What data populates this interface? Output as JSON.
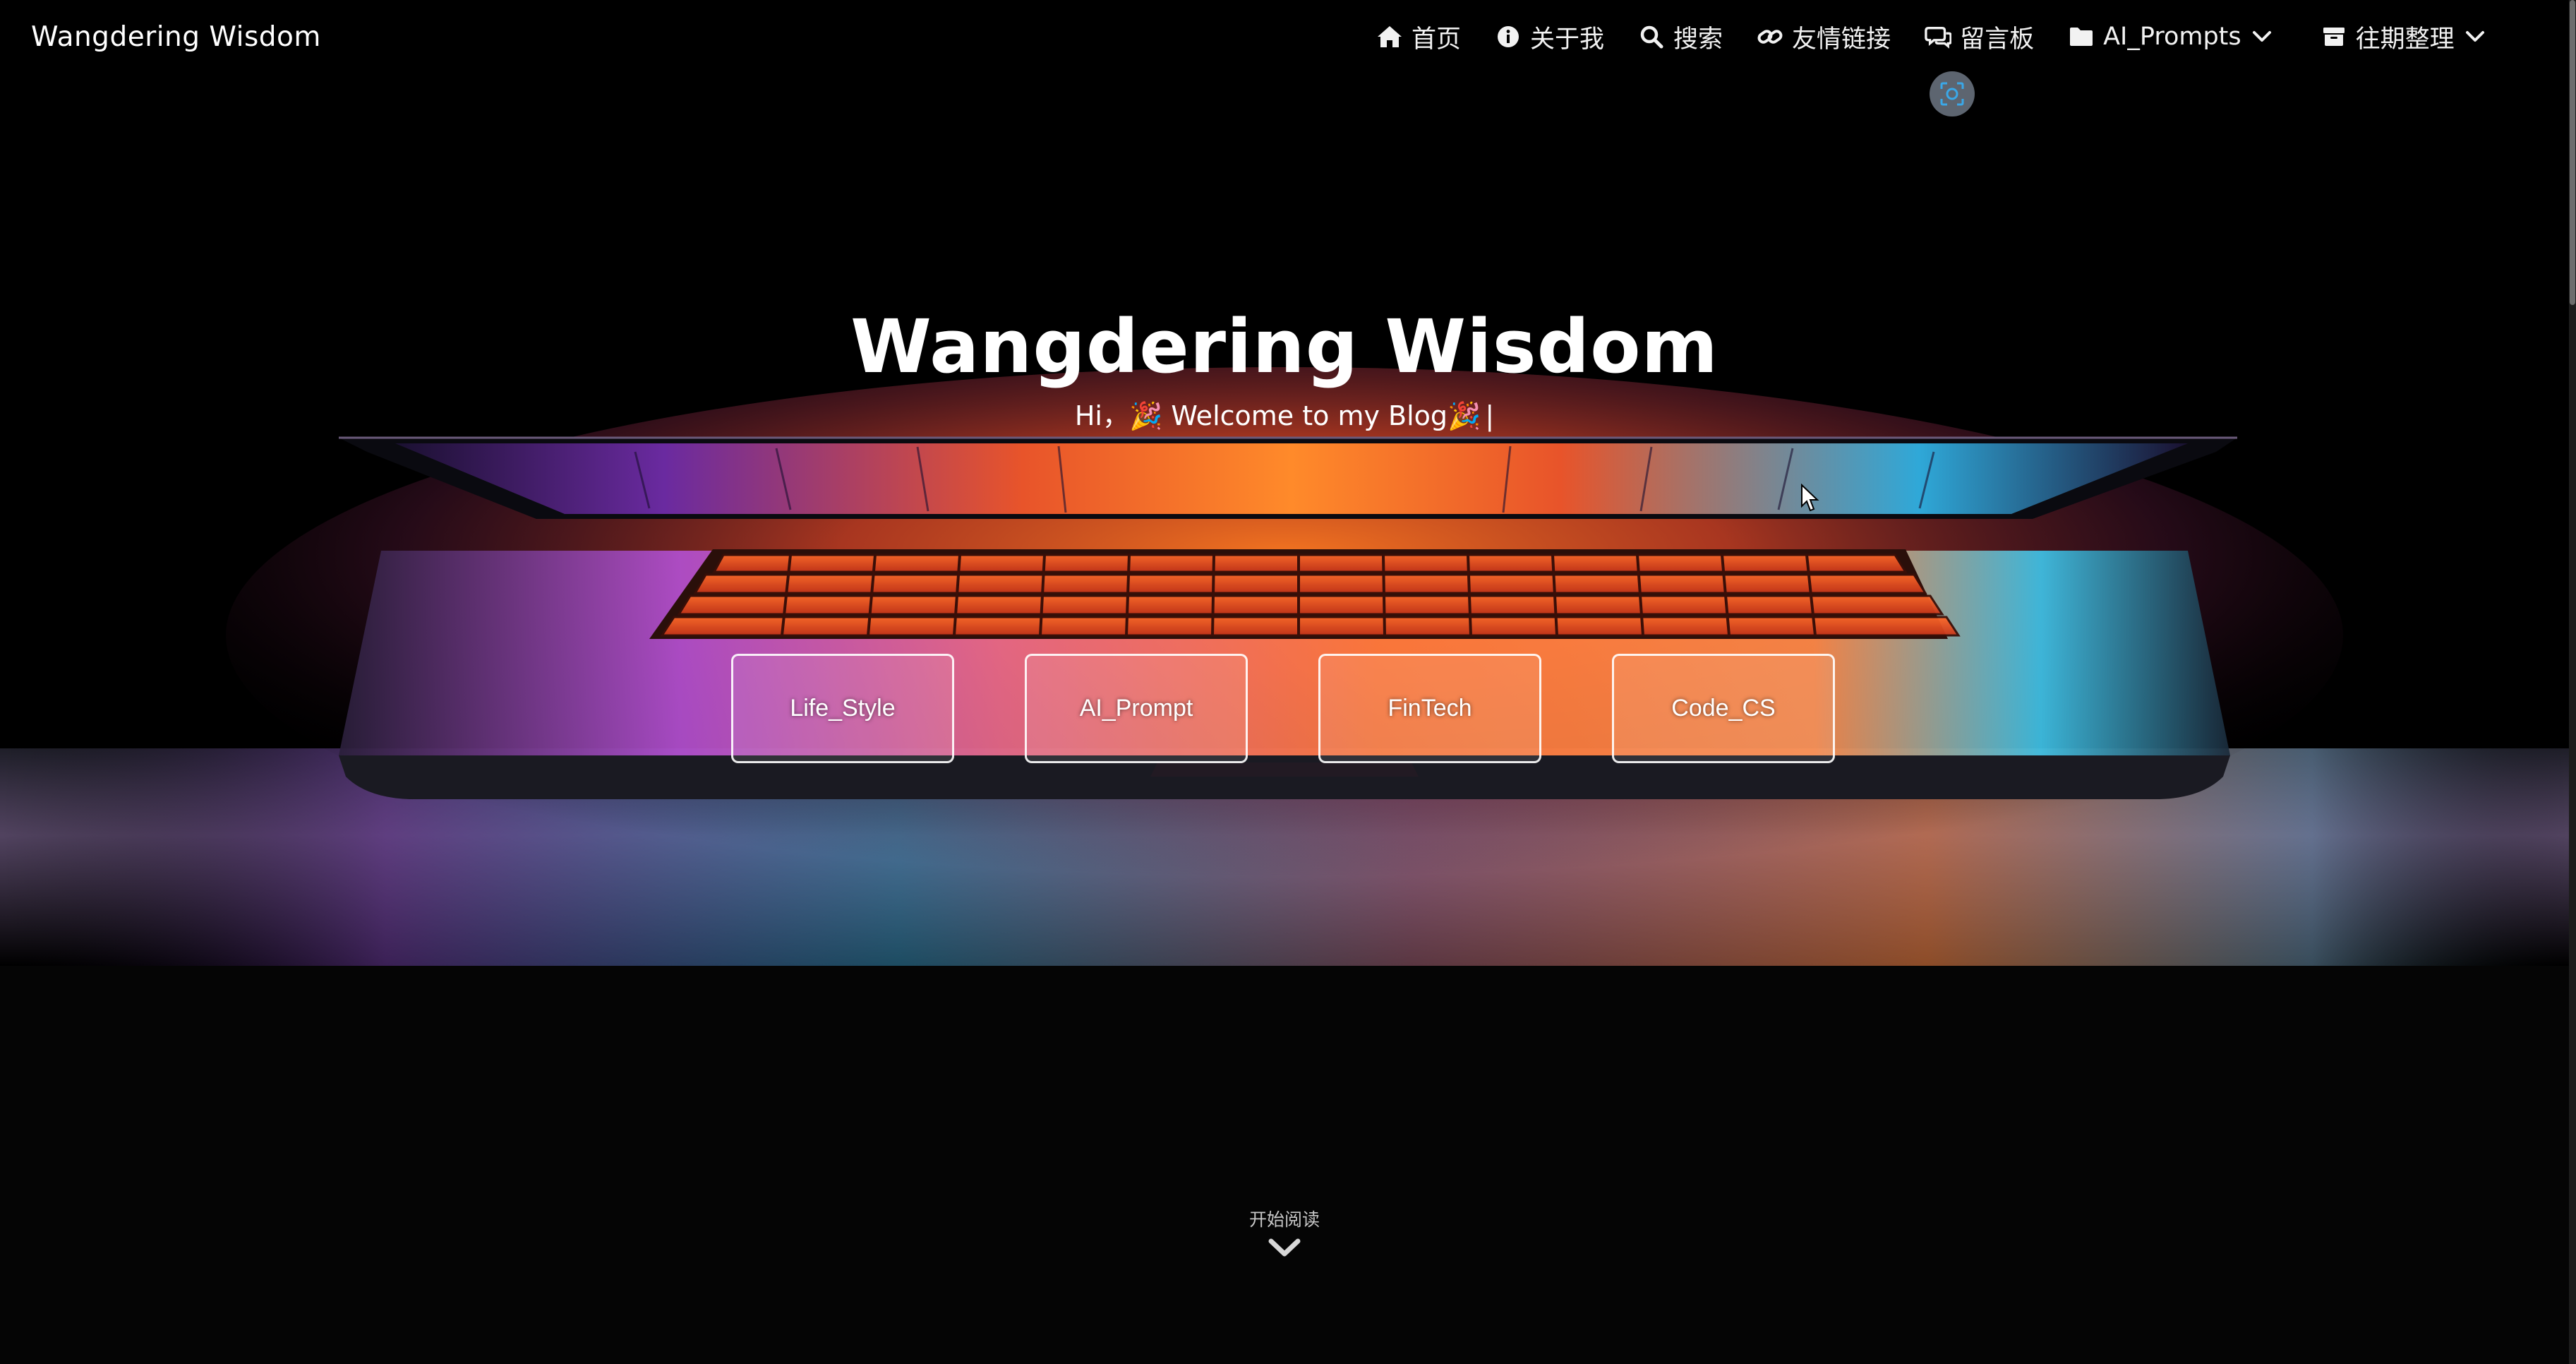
{
  "navbar": {
    "brand": "Wangdering Wisdom",
    "items": [
      {
        "label": "首页",
        "icon": "home-icon",
        "dropdown": false
      },
      {
        "label": "关于我",
        "icon": "info-icon",
        "dropdown": false
      },
      {
        "label": "搜索",
        "icon": "search-icon",
        "dropdown": false
      },
      {
        "label": "友情链接",
        "icon": "link-icon",
        "dropdown": false
      },
      {
        "label": "留言板",
        "icon": "comments-icon",
        "dropdown": false
      },
      {
        "label": "AI_Prompts",
        "icon": "folder-icon",
        "dropdown": true
      },
      {
        "label": "往期整理",
        "icon": "archive-icon",
        "dropdown": true
      }
    ]
  },
  "hero": {
    "title": "Wangdering Wisdom",
    "subtitle": "Hi，🎉 Welcome to my Blog🎉",
    "caret": "|"
  },
  "categories": [
    "Life_Style",
    "AI_Prompt",
    "FinTech",
    "Code_CS"
  ],
  "footer": {
    "start_reading": "开始阅读"
  },
  "colors": {
    "background": "#000000",
    "text": "#ffffff",
    "screen_glow": "#ff6a1a",
    "accent_blue": "#3fc3e8",
    "accent_purple": "#b24fd0"
  }
}
